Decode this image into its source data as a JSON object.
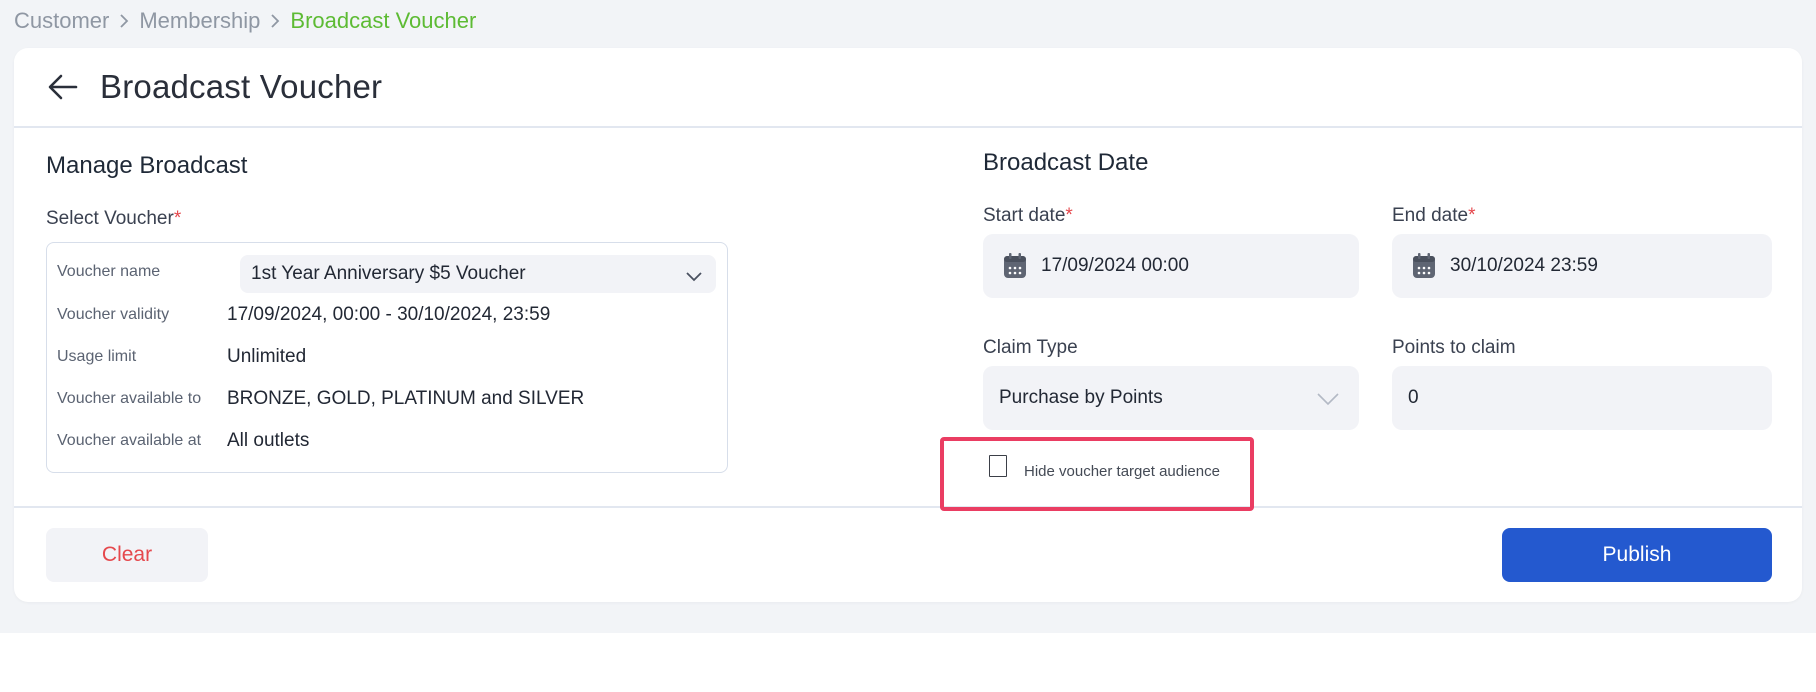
{
  "breadcrumb": {
    "items": [
      "Customer",
      "Membership"
    ],
    "current": "Broadcast Voucher"
  },
  "header": {
    "title": "Broadcast Voucher",
    "back_icon": "arrow-left-icon"
  },
  "manage": {
    "title": "Manage Broadcast",
    "select_label": "Select Voucher",
    "required_mark": "*",
    "details": {
      "name_key": "Voucher name",
      "name_value": "1st Year Anniversary $5 Voucher",
      "validity_key": "Voucher validity",
      "validity_value": "17/09/2024, 00:00 - 30/10/2024, 23:59",
      "usage_key": "Usage limit",
      "usage_value": "Unlimited",
      "available_to_key": "Voucher available to",
      "available_to_value": "BRONZE, GOLD, PLATINUM and SILVER",
      "available_at_key": "Voucher available at",
      "available_at_value": "All outlets"
    }
  },
  "broadcast": {
    "title": "Broadcast Date",
    "start_label": "Start date",
    "start_value": "17/09/2024 00:00",
    "end_label": "End date",
    "end_value": "30/10/2024 23:59",
    "claim_type_label": "Claim Type",
    "claim_type_value": "Purchase by Points",
    "points_label": "Points to claim",
    "points_value": "0",
    "hide_audience_label": "Hide voucher target audience",
    "hide_audience_checked": false
  },
  "footer": {
    "clear_label": "Clear",
    "publish_label": "Publish"
  },
  "colors": {
    "accent_green": "#5dbb34",
    "primary_blue": "#2459cf",
    "danger_red": "#e5484d",
    "highlight_pink": "#ea3d62"
  }
}
